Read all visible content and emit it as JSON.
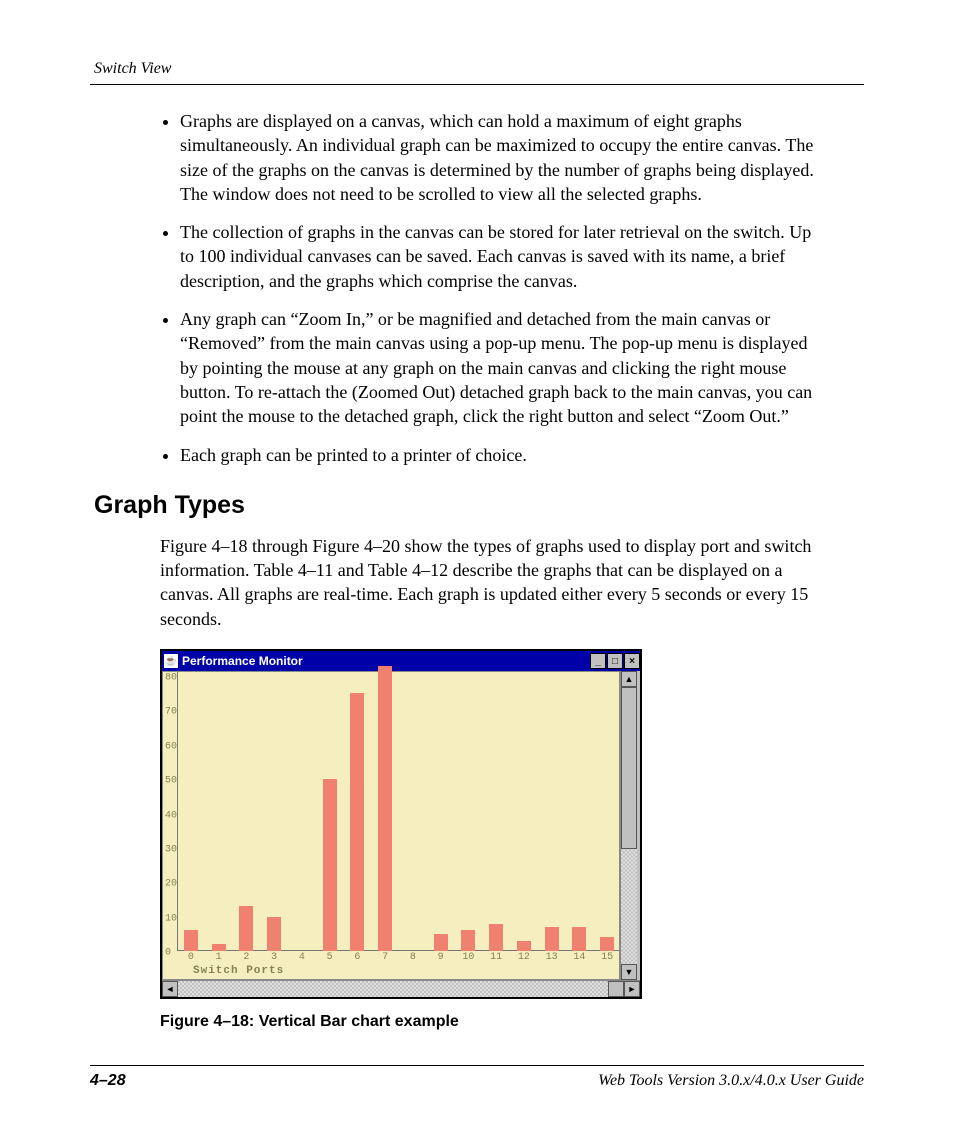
{
  "header": {
    "running_head": "Switch View"
  },
  "bullets": [
    "Graphs are displayed on a canvas, which can hold a maximum of eight graphs simultaneously. An individual graph can be maximized to occupy the entire canvas. The size of the graphs on the canvas is determined by the number of graphs being displayed. The window does not need to be scrolled to view all the selected graphs.",
    "The collection of graphs in the canvas can be stored for later retrieval on the switch. Up to 100 individual canvases can be saved. Each canvas is saved with its name, a brief description, and the graphs which comprise the canvas.",
    "Any graph can “Zoom In,” or be magnified and detached from the main canvas or “Removed” from the main canvas using a pop-up menu. The pop-up menu is displayed by pointing the mouse at any graph on the main canvas and clicking the right mouse button. To re-attach the (Zoomed Out) detached graph back to the main canvas, you can point the mouse to the detached graph, click the right button and select “Zoom Out.”",
    "Each graph can be printed to a printer of choice."
  ],
  "section_heading": "Graph Types",
  "section_para": "Figure 4–18 through Figure 4–20 show the types of graphs used to display port and switch information. Table 4–11 and Table 4–12 describe the graphs that can be displayed on a canvas. All graphs are real-time. Each graph is updated either every 5 seconds or every 15 seconds.",
  "window": {
    "title": "Performance Monitor"
  },
  "chart_data": {
    "type": "bar",
    "title": "Performance Monitor",
    "xlabel": "Switch Ports",
    "ylabel": "",
    "ylim": [
      0,
      80
    ],
    "yticks": [
      0,
      10,
      20,
      30,
      40,
      50,
      60,
      70,
      80
    ],
    "categories": [
      0,
      1,
      2,
      3,
      4,
      5,
      6,
      7,
      8,
      9,
      10,
      11,
      12,
      13,
      14,
      15
    ],
    "values": [
      6,
      2,
      13,
      10,
      0,
      50,
      75,
      83,
      0,
      5,
      6,
      8,
      3,
      7,
      7,
      4
    ],
    "bar_color": "#f08070",
    "plot_bg": "#f5efc0"
  },
  "figure_caption": "Figure 4–18:  Vertical Bar chart example",
  "footer": {
    "page_number": "4–28",
    "doc_title": "Web Tools Version 3.0.x/4.0.x User Guide"
  }
}
